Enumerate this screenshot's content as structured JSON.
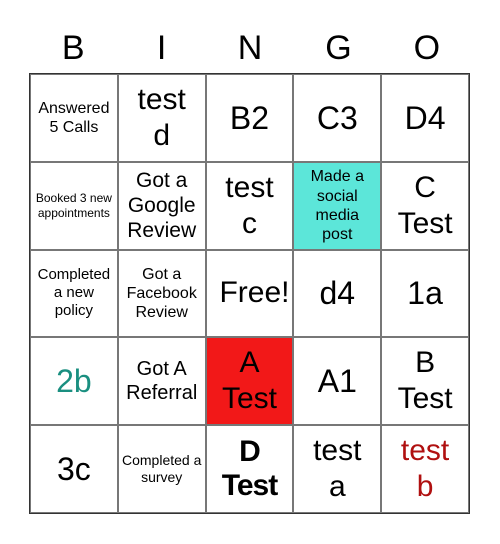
{
  "header": [
    "B",
    "I",
    "N",
    "G",
    "O"
  ],
  "colors": {
    "marked_red": "#f21818",
    "marked_teal": "#5ce6d9",
    "text_teal": "#1a8f80",
    "text_red": "#b01010"
  },
  "cells": [
    [
      {
        "text": "Answered 5 Calls",
        "size": 16
      },
      {
        "text": "test d",
        "size": 30
      },
      {
        "text": "B2",
        "size": 32
      },
      {
        "text": "C3",
        "size": 32
      },
      {
        "text": "D4",
        "size": 32
      }
    ],
    [
      {
        "text": "Booked 3 new appointments",
        "size": 12
      },
      {
        "text": "Got a Google Review",
        "size": 21
      },
      {
        "text": "test c",
        "size": 30
      },
      {
        "text": "Made a social media post",
        "size": 16,
        "bg": "#5ce6d9"
      },
      {
        "text": "C Test",
        "size": 30
      }
    ],
    [
      {
        "text": "Completed a new policy",
        "size": 15
      },
      {
        "text": "Got a Facebook Review",
        "size": 16
      },
      {
        "text": "Free!",
        "size": 30
      },
      {
        "text": "d4",
        "size": 32
      },
      {
        "text": "1a",
        "size": 32
      }
    ],
    [
      {
        "text": "2b",
        "size": 32,
        "color": "#1a8f80"
      },
      {
        "text": "Got A Referral",
        "size": 20
      },
      {
        "text": "A Test",
        "size": 30,
        "bg": "#f21818"
      },
      {
        "text": "A1",
        "size": 32
      },
      {
        "text": "B Test",
        "size": 30
      }
    ],
    [
      {
        "text": "3c",
        "size": 32
      },
      {
        "text": "Completed a survey",
        "size": 14
      },
      {
        "text": "D Test",
        "size": 30,
        "bold": true
      },
      {
        "text": "test a",
        "size": 30
      },
      {
        "text": "test b",
        "size": 30,
        "color": "#b01010"
      }
    ]
  ]
}
